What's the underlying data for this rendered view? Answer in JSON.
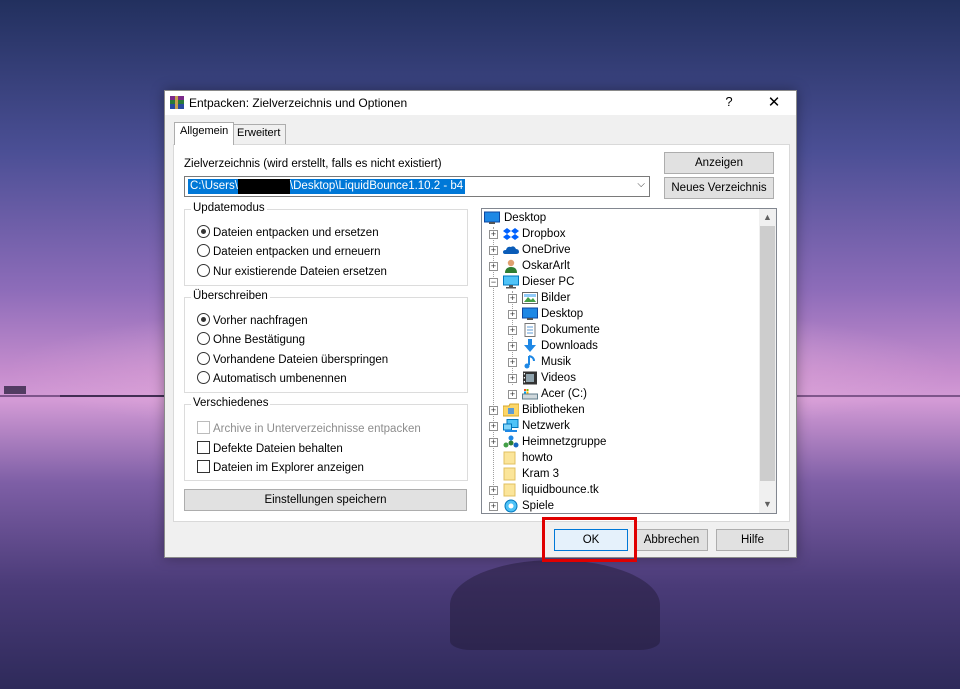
{
  "window": {
    "title": "Entpacken: Zielverzeichnis und Optionen",
    "help": "?",
    "close": "✕"
  },
  "tabs": [
    {
      "label": "Allgemein",
      "active": true
    },
    {
      "label": "Erweitert",
      "active": false
    }
  ],
  "target": {
    "label": "Zielverzeichnis (wird erstellt, falls es nicht existiert)",
    "path_prefix": "C:\\Users\\",
    "path_suffix": "\\Desktop\\LiquidBounce1.10.2 - b4",
    "show_button": "Anzeigen",
    "new_folder_button": "Neues Verzeichnis"
  },
  "update_mode": {
    "title": "Updatemodus",
    "options": [
      {
        "label": "Dateien entpacken und ersetzen",
        "selected": true
      },
      {
        "label": "Dateien entpacken und erneuern",
        "selected": false
      },
      {
        "label": "Nur existierende Dateien ersetzen",
        "selected": false
      }
    ]
  },
  "overwrite": {
    "title": "Überschreiben",
    "options": [
      {
        "label": "Vorher nachfragen",
        "selected": true
      },
      {
        "label": "Ohne Bestätigung",
        "selected": false
      },
      {
        "label": "Vorhandene Dateien überspringen",
        "selected": false
      },
      {
        "label": "Automatisch umbenennen",
        "selected": false
      }
    ]
  },
  "misc": {
    "title": "Verschiedenes",
    "options": [
      {
        "label": "Archive in Unterverzeichnisse entpacken",
        "checked": false,
        "disabled": true
      },
      {
        "label": "Defekte Dateien behalten",
        "checked": false,
        "disabled": false
      },
      {
        "label": "Dateien im Explorer anzeigen",
        "checked": false,
        "disabled": false
      }
    ]
  },
  "save_settings_button": "Einstellungen speichern",
  "tree": [
    {
      "label": "Desktop",
      "icon": "desktop-icon"
    },
    {
      "label": "Dropbox",
      "icon": "dropbox-icon"
    },
    {
      "label": "OneDrive",
      "icon": "onedrive-icon"
    },
    {
      "label": "OskarArlt",
      "icon": "user-icon"
    },
    {
      "label": "Dieser PC",
      "icon": "pc-icon"
    },
    {
      "label": "Bilder",
      "icon": "pictures-icon"
    },
    {
      "label": "Desktop",
      "icon": "desktop-icon"
    },
    {
      "label": "Dokumente",
      "icon": "documents-icon"
    },
    {
      "label": "Downloads",
      "icon": "downloads-icon"
    },
    {
      "label": "Musik",
      "icon": "music-icon"
    },
    {
      "label": "Videos",
      "icon": "videos-icon"
    },
    {
      "label": "Acer (C:)",
      "icon": "drive-icon"
    },
    {
      "label": "Bibliotheken",
      "icon": "libraries-icon"
    },
    {
      "label": "Netzwerk",
      "icon": "network-icon"
    },
    {
      "label": "Heimnetzgruppe",
      "icon": "homegroup-icon"
    },
    {
      "label": "howto",
      "icon": "folder-icon"
    },
    {
      "label": "Kram 3",
      "icon": "folder-icon"
    },
    {
      "label": "liquidbounce.tk",
      "icon": "folder-icon"
    },
    {
      "label": "Spiele",
      "icon": "games-icon"
    }
  ],
  "footer": {
    "ok": "OK",
    "cancel": "Abbrechen",
    "help": "Hilfe"
  },
  "colors": {
    "accent": "#0078d7",
    "highlight": "#e00000"
  }
}
